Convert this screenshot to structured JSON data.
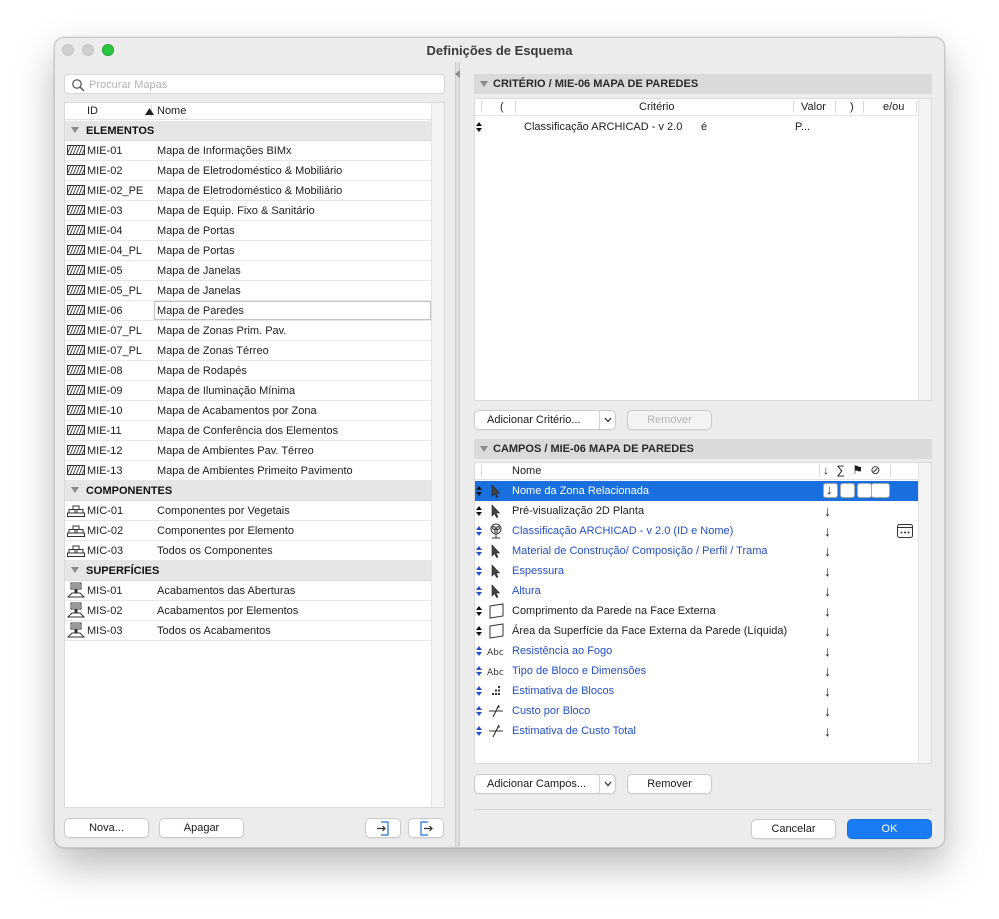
{
  "window": {
    "title": "Definições de Esquema"
  },
  "search": {
    "placeholder": "Procurar Mapas"
  },
  "list": {
    "col_id": "ID",
    "col_name": "Nome",
    "groups": [
      {
        "label": "ELEMENTOS",
        "icon": "wall-hatch-icon",
        "items": [
          {
            "id": "MIE-01",
            "name": "Mapa de Informações BIMx"
          },
          {
            "id": "MIE-02",
            "name": "Mapa de Eletrodoméstico & Mobiliário"
          },
          {
            "id": "MIE-02_PE",
            "name": "Mapa de Eletrodoméstico & Mobiliário"
          },
          {
            "id": "MIE-03",
            "name": "Mapa de Equip. Fixo & Sanitário"
          },
          {
            "id": "MIE-04",
            "name": "Mapa de Portas"
          },
          {
            "id": "MIE-04_PL",
            "name": "Mapa de Portas"
          },
          {
            "id": "MIE-05",
            "name": "Mapa de Janelas"
          },
          {
            "id": "MIE-05_PL",
            "name": "Mapa de Janelas"
          },
          {
            "id": "MIE-06",
            "name": "Mapa de Paredes"
          },
          {
            "id": "MIE-07_PL",
            "name": "Mapa de Zonas Prim. Pav."
          },
          {
            "id": "MIE-07_PL",
            "name": "Mapa de Zonas Térreo"
          },
          {
            "id": "MIE-08",
            "name": "Mapa de Rodapés"
          },
          {
            "id": "MIE-09",
            "name": "Mapa de Iluminação Mínima"
          },
          {
            "id": "MIE-10",
            "name": "Mapa de Acabamentos por Zona"
          },
          {
            "id": "MIE-11",
            "name": "Mapa de Conferência dos Elementos"
          },
          {
            "id": "MIE-12",
            "name": "Mapa de Ambientes Pav. Térreo"
          },
          {
            "id": "MIE-13",
            "name": "Mapa de Ambientes Primeito Pavimento"
          }
        ]
      },
      {
        "label": "COMPONENTES",
        "icon": "components-icon",
        "items": [
          {
            "id": "MIC-01",
            "name": "Componentes por Vegetais"
          },
          {
            "id": "MIC-02",
            "name": "Componentes por Elemento"
          },
          {
            "id": "MIC-03",
            "name": "Todos os Componentes"
          }
        ]
      },
      {
        "label": "SUPERFÍCIES",
        "icon": "paint-brush-icon",
        "items": [
          {
            "id": "MIS-01",
            "name": "Acabamentos das Aberturas"
          },
          {
            "id": "MIS-02",
            "name": "Acabamentos por Elementos"
          },
          {
            "id": "MIS-03",
            "name": "Todos os Acabamentos"
          }
        ]
      }
    ]
  },
  "left_buttons": {
    "new": "Nova...",
    "delete": "Apagar"
  },
  "criteria": {
    "title": "CRITÉRIO / MIE-06 MAPA DE PAREDES",
    "col_open": "(",
    "col_criterion": "Critério",
    "col_value": "Valor",
    "col_close": ")",
    "col_andor": "e/ou",
    "row": {
      "criterion": "Classificação ARCHICAD - v 2.0",
      "operator": "é",
      "value": "P..."
    },
    "add_button": "Adicionar Critério...",
    "remove_button": "Remover"
  },
  "fields": {
    "title": "CAMPOS / MIE-06 MAPA DE PAREDES",
    "col_name": "Nome",
    "col_icons": "↓ ∑ ⚑ ⊘",
    "rows": [
      {
        "name": "Nome da Zona Relacionada",
        "icon": "pointer-icon",
        "blue": false
      },
      {
        "name": "Pré-visualização 2D Planta",
        "icon": "pointer-icon",
        "blue": false
      },
      {
        "name": "Classificação ARCHICAD - v 2.0 (ID e Nome)",
        "icon": "classification-icon",
        "blue": true
      },
      {
        "name": "Material de Construção/ Composição / Perfil / Trama",
        "icon": "pointer-icon",
        "blue": true
      },
      {
        "name": "Espessura",
        "icon": "pointer-icon",
        "blue": true
      },
      {
        "name": "Altura",
        "icon": "pointer-icon",
        "blue": true
      },
      {
        "name": "Comprimento da Parede na Face Externa",
        "icon": "surface-icon",
        "blue": false
      },
      {
        "name": "Área da Superfície da Face Externa da Parede (Líquida)",
        "icon": "surface-icon",
        "blue": false
      },
      {
        "name": "Resistência ao Fogo",
        "icon": "text-abc-icon",
        "blue": true
      },
      {
        "name": "Tipo de Bloco e Dimensões",
        "icon": "text-abc-icon",
        "blue": true
      },
      {
        "name": "Estimativa de Blocos",
        "icon": "dots-icon",
        "blue": true
      },
      {
        "name": "Custo por Bloco",
        "icon": "formula-icon",
        "blue": true
      },
      {
        "name": "Estimativa de Custo Total",
        "icon": "formula-icon",
        "blue": true
      }
    ],
    "add_button": "Adicionar Campos...",
    "remove_button": "Remover"
  },
  "dialog_buttons": {
    "cancel": "Cancelar",
    "ok": "OK"
  },
  "colors": {
    "selection": "#1a6fde",
    "ok": "#1a7cf5",
    "link_blue": "#2350c8"
  }
}
